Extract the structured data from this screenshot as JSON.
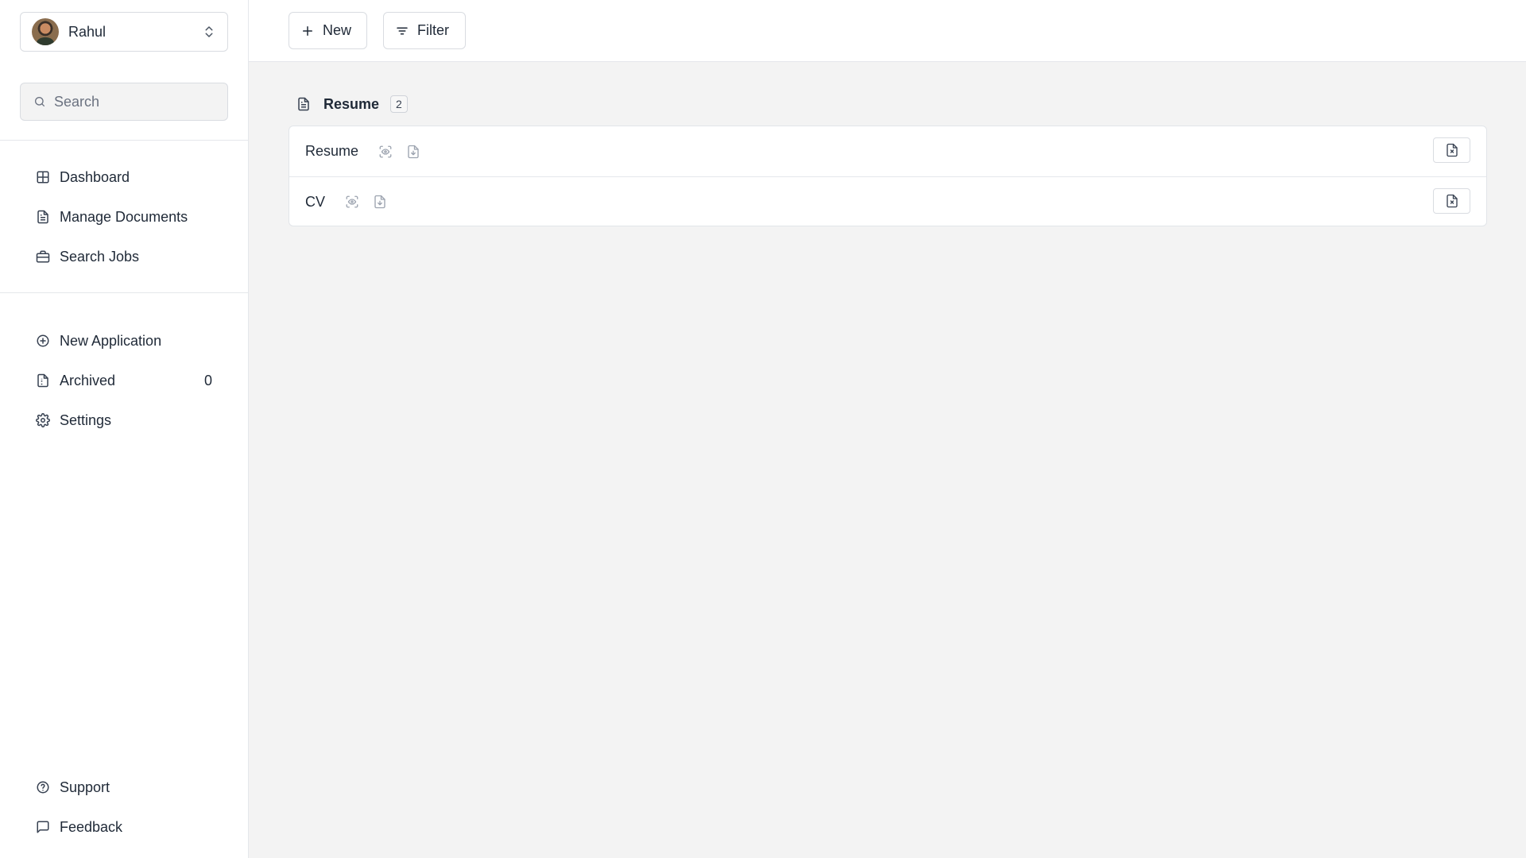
{
  "sidebar": {
    "user": {
      "name": "Rahul",
      "avatar_icon": "avatar-photo",
      "switch_icon": "chevrons-up-down-icon"
    },
    "search": {
      "placeholder": "Search",
      "value": ""
    },
    "primary_nav": [
      {
        "label": "Dashboard",
        "icon": "grid-icon"
      },
      {
        "label": "Manage Documents",
        "icon": "document-icon"
      },
      {
        "label": "Search Jobs",
        "icon": "briefcase-icon"
      }
    ],
    "secondary_nav": [
      {
        "label": "New Application",
        "icon": "plus-circle-icon"
      },
      {
        "label": "Archived",
        "icon": "archive-file-icon",
        "count": "0"
      },
      {
        "label": "Settings",
        "icon": "gear-icon"
      }
    ],
    "footer_nav": [
      {
        "label": "Support",
        "icon": "help-circle-icon"
      },
      {
        "label": "Feedback",
        "icon": "message-square-icon"
      }
    ]
  },
  "toolbar": {
    "new_label": "New",
    "filter_label": "Filter"
  },
  "group": {
    "title": "Resume",
    "count": "2",
    "documents": [
      {
        "name": "Resume"
      },
      {
        "name": "CV"
      }
    ]
  },
  "colors": {
    "background": "#f3f3f3",
    "surface": "#ffffff",
    "border": "#e5e7eb",
    "text": "#1f2937",
    "muted_icon": "#9ca3af"
  }
}
